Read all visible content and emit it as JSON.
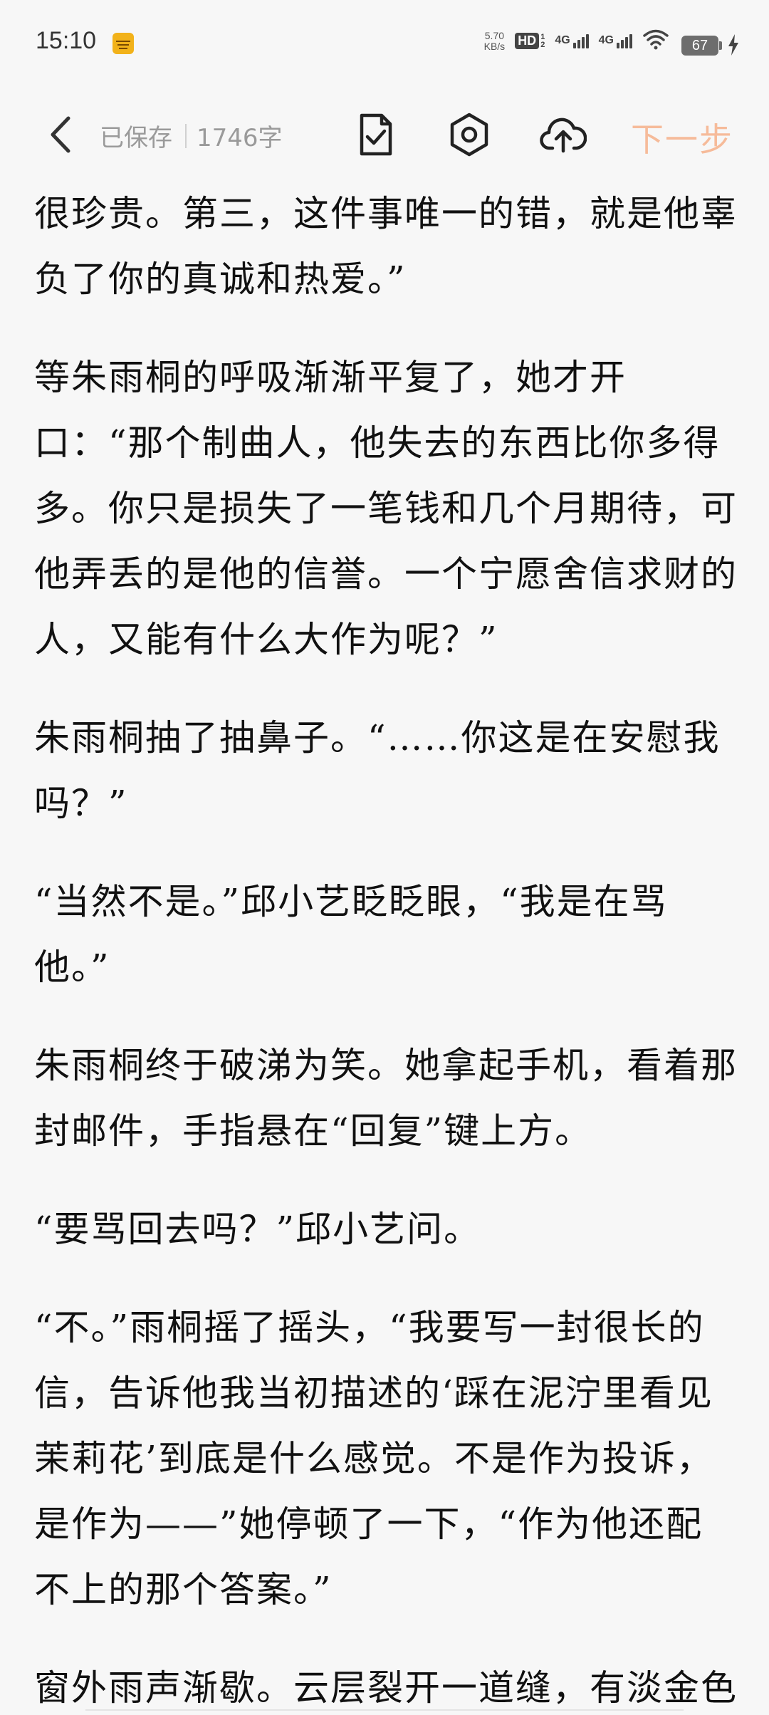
{
  "status_bar": {
    "time": "15:10",
    "net_speed_value": "5.70",
    "net_speed_unit": "KB/s",
    "hd_label": "HD",
    "hd_sim_top": "1",
    "hd_sim_bottom": "2",
    "signal_1_label": "4G",
    "signal_2_label": "4G",
    "battery_level": "67"
  },
  "toolbar": {
    "save_status": "已保存",
    "word_count": "1746字",
    "next_label": "下一步",
    "next_color": "#f6bb9a"
  },
  "content": {
    "paragraphs": [
      "很珍贵。第三，这件事唯一的错，就是他辜负了你的真诚和热爱。”",
      "等朱雨桐的呼吸渐渐平复了，她才开口：“那个制曲人，他失去的东西比你多得多。你只是损失了一笔钱和几个月期待，可他弄丢的是他的信誉。一个宁愿舍信求财的人，又能有什么大作为呢？”",
      "朱雨桐抽了抽鼻子。“……你这是在安慰我吗？”",
      "“当然不是。”邱小艺眨眨眼，“我是在骂他。”",
      "朱雨桐终于破涕为笑。她拿起手机，看着那封邮件，手指悬在“回复”键上方。",
      "“要骂回去吗？”邱小艺问。",
      "“不。”雨桐摇了摇头，“我要写一封很长的信，告诉他我当初描述的‘踩在泥泞里看见茉莉花’到底是什么感觉。不是作为投诉，是作为——”她停顿了一下，“作为他还配不上的那个答案。”",
      "窗外雨声渐歇。云层裂开一道缝，有淡金色"
    ]
  }
}
